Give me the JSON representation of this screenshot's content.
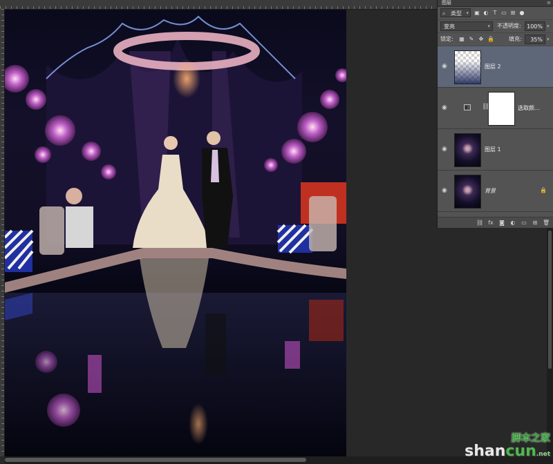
{
  "panel": {
    "tab_label": "图层",
    "menu_glyph": "≡",
    "filter": {
      "kind_label": "类型"
    },
    "blend_mode": "变亮",
    "opacity_label": "不透明度:",
    "opacity_value": "100%",
    "lock_label": "锁定:",
    "fill_label": "填充:",
    "fill_value": "35%",
    "layers": [
      {
        "name": "图层 2",
        "selected": true
      },
      {
        "name": "选取颜..."
      },
      {
        "name": "图层 1"
      },
      {
        "name": "背景",
        "locked": true
      }
    ]
  },
  "watermark": {
    "top": "脚本之家",
    "shan": "shan",
    "cun": "cun",
    "net": ".net"
  },
  "colors": {
    "panel_bg": "#535353",
    "selected_layer": "#5e6778",
    "app_bg": "#282828"
  }
}
